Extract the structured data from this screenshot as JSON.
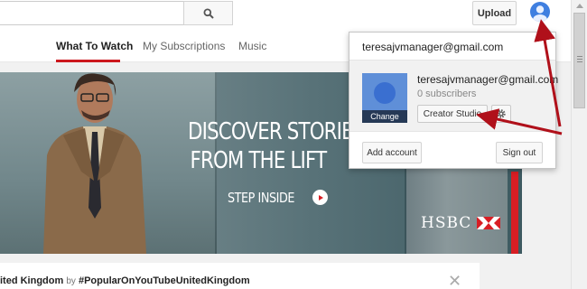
{
  "header": {
    "search_placeholder": "",
    "search_icon": "search-icon",
    "upload_label": "Upload",
    "avatar_icon": "account-avatar-icon"
  },
  "nav": {
    "tabs": [
      {
        "label": "What To Watch",
        "active": true
      },
      {
        "label": "My Subscriptions",
        "active": false
      },
      {
        "label": "Music",
        "active": false
      }
    ]
  },
  "banner": {
    "headline_line1": "DISCOVER STORIES",
    "headline_line2": "FROM THE LIFT",
    "cta": "STEP INSIDE",
    "brand": "HSBC",
    "brand_color": "#d81e24"
  },
  "feed": {
    "title": "ited Kingdom",
    "by": "by",
    "tag": "#PopularOnYouTubeUnitedKingdom",
    "close_icon": "close-icon"
  },
  "account_menu": {
    "email_top": "teresajvmanager@gmail.com",
    "name": "teresajvmanager@gmail.com",
    "subscribers": "0 subscribers",
    "change_label": "Change",
    "creator_studio_label": "Creator Studio",
    "settings_icon": "gear-icon",
    "add_account_label": "Add account",
    "sign_out_label": "Sign out"
  },
  "colors": {
    "accent_red": "#cc181e",
    "annotation_arrow": "#b0101a",
    "avatar_blue": "#3f7fe0"
  }
}
